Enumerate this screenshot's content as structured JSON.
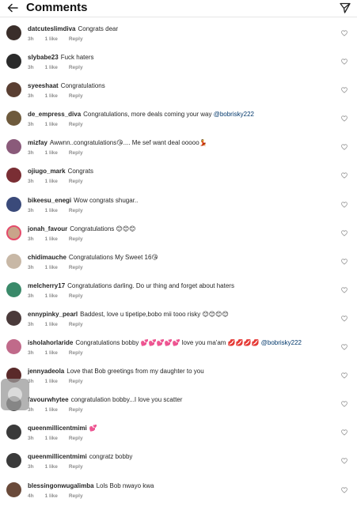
{
  "header": {
    "title": "Comments"
  },
  "labels": {
    "reply": "Reply"
  },
  "comments": [
    {
      "user": "datcuteslimdiva",
      "text": "Congrats dear",
      "mention": "",
      "time": "3h",
      "likes": "1 like",
      "avatar": "#3a2e2a",
      "ring": false
    },
    {
      "user": "slybabe23",
      "text": "Fuck haters",
      "mention": "",
      "time": "3h",
      "likes": "1 like",
      "avatar": "#2b2b2b",
      "ring": false
    },
    {
      "user": "syeeshaat",
      "text": "Congratulations",
      "mention": "",
      "time": "3h",
      "likes": "1 like",
      "avatar": "#5a3f32",
      "ring": false
    },
    {
      "user": "de_empress_diva",
      "text": "Congratulations, more deals coming your way",
      "mention": "@bobrisky222",
      "time": "3h",
      "likes": "1 like",
      "avatar": "#6e5a3c",
      "ring": false
    },
    {
      "user": "mizfay",
      "text": "Awwnn..congratulations😘.... Me sef want deal ooooo💃",
      "mention": "",
      "time": "3h",
      "likes": "1 like",
      "avatar": "#8a5a7a",
      "ring": false
    },
    {
      "user": "ojiugo_mark",
      "text": "Congrats",
      "mention": "",
      "time": "3h",
      "likes": "1 like",
      "avatar": "#7a2e34",
      "ring": false
    },
    {
      "user": "bikeesu_enegi",
      "text": "Wow congrats shugar..",
      "mention": "",
      "time": "3h",
      "likes": "1 like",
      "avatar": "#3a4a7a",
      "ring": false
    },
    {
      "user": "jonah_favour",
      "text": "Congratulations 😊😊😊",
      "mention": "",
      "time": "3h",
      "likes": "1 like",
      "avatar": "#c9a48a",
      "ring": true
    },
    {
      "user": "chidimauche",
      "text": "Congratulations My Sweet 16😘",
      "mention": "",
      "time": "3h",
      "likes": "1 like",
      "avatar": "#c8b8a6",
      "ring": false
    },
    {
      "user": "melcherry17",
      "text": "Congratulations darling. Do ur thing and forget about haters",
      "mention": "",
      "time": "3h",
      "likes": "1 like",
      "avatar": "#3a8a6a",
      "ring": false
    },
    {
      "user": "ennypinky_pearl",
      "text": "Baddest, love u tipetipe,bobo mii tooo risky 😊😊😊😊",
      "mention": "",
      "time": "3h",
      "likes": "1 like",
      "avatar": "#4a3a3a",
      "ring": false
    },
    {
      "user": "isholahorlaride",
      "text": "Congratulations bobby 💕💕💕💕💕 love you ma'am 💋💋💋💋",
      "mention": "@bobrisky222",
      "time": "3h",
      "likes": "1 like",
      "avatar": "#c06a8a",
      "ring": false
    },
    {
      "user": "jennyadeola",
      "text": "Love that Bob greetings from my daughter to you",
      "mention": "",
      "time": "3h",
      "likes": "1 like",
      "avatar": "#5a2a2a",
      "ring": false
    },
    {
      "user": "favourwhytee",
      "text": "congratulation bobby...I love you scatter",
      "mention": "",
      "time": "3h",
      "likes": "1 like",
      "avatar": "#4a4a4a",
      "ring": false
    },
    {
      "user": "queenmillicentmimi",
      "text": "💕",
      "mention": "",
      "time": "3h",
      "likes": "1 like",
      "avatar": "#3a3a3a",
      "ring": false
    },
    {
      "user": "queenmillicentmimi",
      "text": "congratz bobby",
      "mention": "",
      "time": "3h",
      "likes": "1 like",
      "avatar": "#3a3a3a",
      "ring": false
    },
    {
      "user": "blessingonwugalimba",
      "text": "Lols Bob nwayo kwa",
      "mention": "",
      "time": "4h",
      "likes": "1 like",
      "avatar": "#6a4a3a",
      "ring": false
    }
  ]
}
